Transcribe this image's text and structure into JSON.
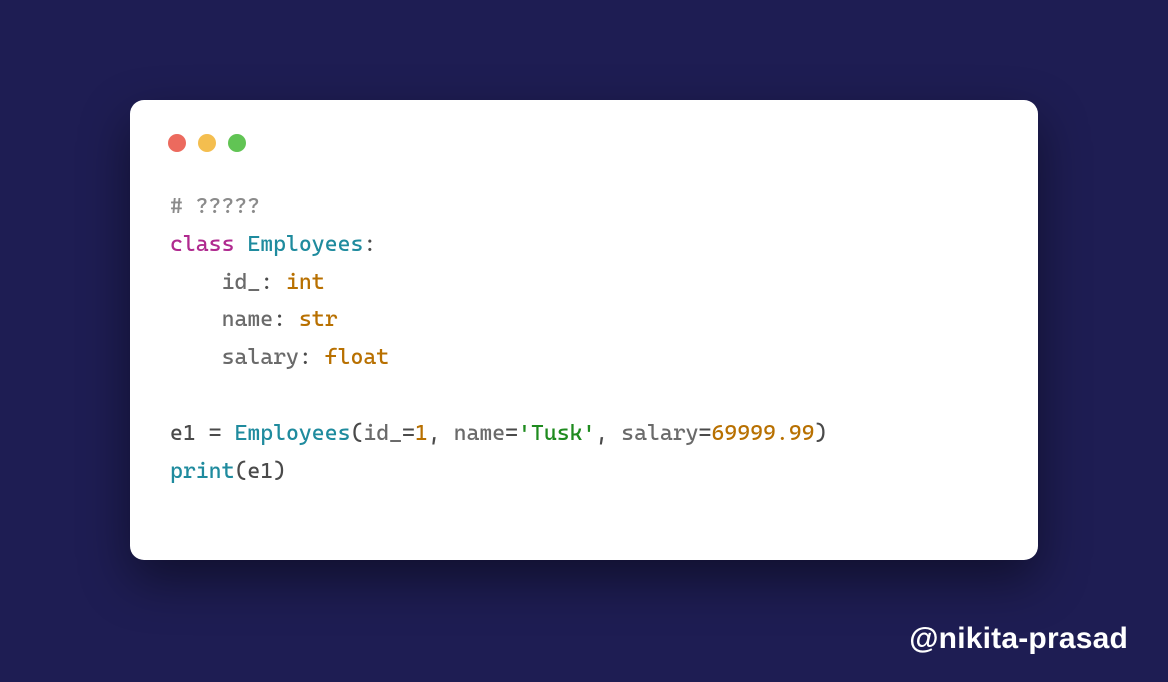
{
  "colors": {
    "bg": "#1e1d53",
    "card": "#ffffff",
    "dot_red": "#ec6a5e",
    "dot_yellow": "#f4be4f",
    "dot_green": "#61c454"
  },
  "code": {
    "l1_comment": "# ?????",
    "l2_kw_class": "class",
    "l2_space1": " ",
    "l2_classname": "Employees",
    "l2_colon": ":",
    "l3_indent": "    ",
    "l3_attr": "id_",
    "l3_colon": ": ",
    "l3_type": "int",
    "l4_indent": "    ",
    "l4_attr": "name",
    "l4_colon": ": ",
    "l4_type": "str",
    "l5_indent": "    ",
    "l5_attr": "salary",
    "l5_colon": ": ",
    "l5_type": "float",
    "l7_var": "e1",
    "l7_eq": " = ",
    "l7_classname": "Employees",
    "l7_open": "(",
    "l7_k1": "id_",
    "l7_eq1": "=",
    "l7_v1": "1",
    "l7_c1": ", ",
    "l7_k2": "name",
    "l7_eq2": "=",
    "l7_v2": "'Tusk'",
    "l7_c2": ", ",
    "l7_k3": "salary",
    "l7_eq3": "=",
    "l7_v3": "69999.99",
    "l7_close": ")",
    "l8_builtin": "print",
    "l8_open": "(",
    "l8_arg": "e1",
    "l8_close": ")"
  },
  "credit": "@nikita-prasad"
}
